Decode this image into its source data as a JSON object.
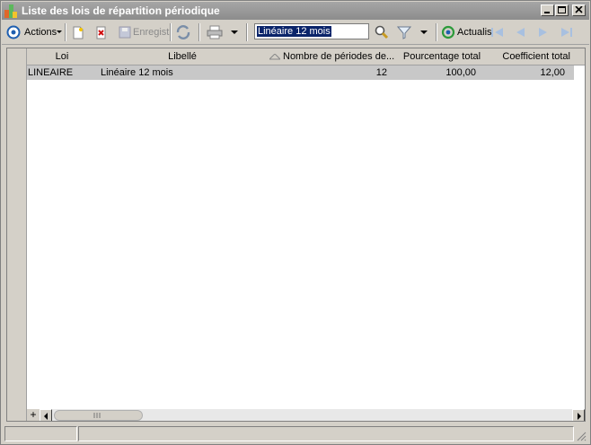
{
  "window": {
    "title": "Liste des lois de répartition périodique"
  },
  "toolbar": {
    "actions_label": "Actions",
    "save_label": "Enregist",
    "search_value": "Linéaire 12 mois",
    "refresh_label": "Actualis"
  },
  "table": {
    "columns": [
      "Loi",
      "Libellé",
      "Nombre de périodes de...",
      "Pourcentage total",
      "Coefficient total"
    ],
    "rows": [
      {
        "loi": "LINEAIRE",
        "libelle": "Linéaire 12 mois",
        "nombre": "12",
        "pourcentage": "100,00",
        "coefficient": "12,00"
      }
    ]
  },
  "colors": {
    "title_bar": "#8c8c8c",
    "selection": "#0a246a",
    "row_bg": "#c8c8c8"
  }
}
